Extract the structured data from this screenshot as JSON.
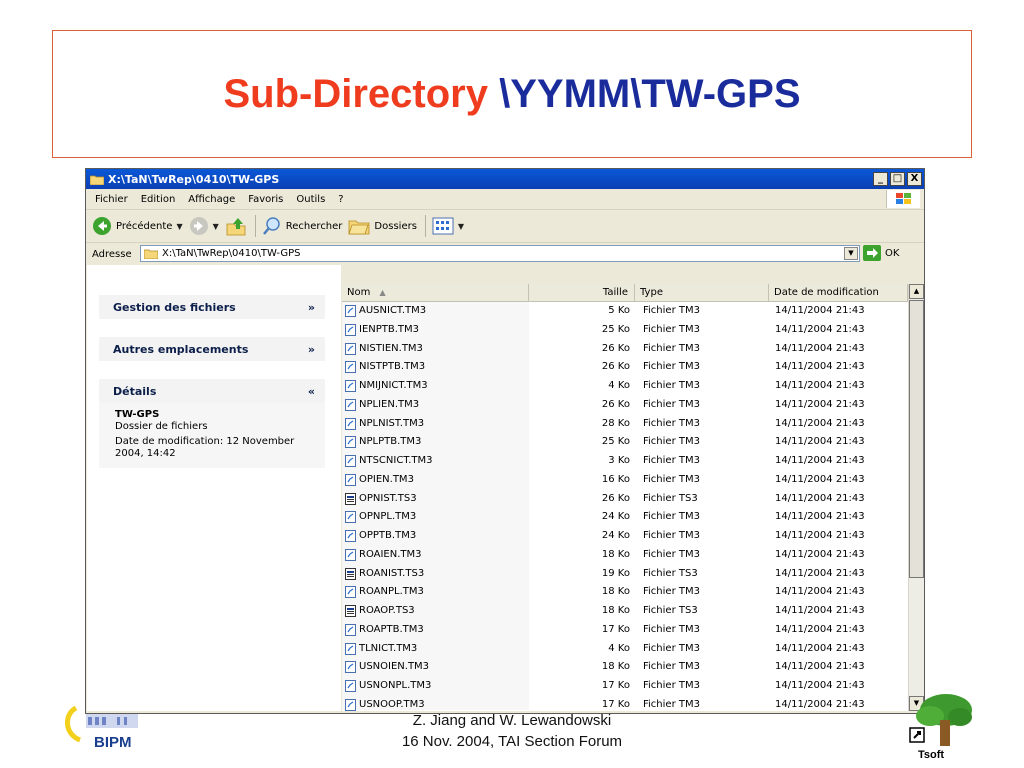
{
  "slide": {
    "title_part1": "Sub-Directory ",
    "title_part2": "\\YYMM\\TW-GPS",
    "footer_line1": "Z. Jiang and W. Lewandowski",
    "footer_line2": "16 Nov. 2004, TAI Section Forum",
    "logo_left": "BIPM",
    "logo_right": "Tsoft"
  },
  "window": {
    "title": "X:\\TaN\\TwRep\\0410\\TW-GPS",
    "controls": [
      "_",
      "□",
      "X"
    ]
  },
  "menu": [
    "Fichier",
    "Edition",
    "Affichage",
    "Favoris",
    "Outils",
    "?"
  ],
  "toolbar": {
    "back_label": "Précédente",
    "search_label": "Rechercher",
    "folders_label": "Dossiers"
  },
  "address": {
    "label": "Adresse",
    "value": "X:\\TaN\\TwRep\\0410\\TW-GPS",
    "go_label": "OK"
  },
  "taskpane": {
    "sections": [
      {
        "title": "Gestion des fichiers",
        "chevron": "»"
      },
      {
        "title": "Autres emplacements",
        "chevron": "»"
      },
      {
        "title": "Détails",
        "chevron": "«"
      }
    ],
    "details": {
      "name": "TW-GPS",
      "kind": "Dossier de fichiers",
      "modified": "Date de modification: 12 November 2004, 14:42"
    }
  },
  "columns": [
    "Nom",
    "Taille",
    "Type",
    "Date de modification"
  ],
  "files": [
    {
      "name": "AUSNICT.TM3",
      "size": "5 Ko",
      "type": "Fichier TM3",
      "date": "14/11/2004 21:43",
      "icon": "doc-icon"
    },
    {
      "name": "IENPTB.TM3",
      "size": "25 Ko",
      "type": "Fichier TM3",
      "date": "14/11/2004 21:43",
      "icon": "doc-icon"
    },
    {
      "name": "NISTIEN.TM3",
      "size": "26 Ko",
      "type": "Fichier TM3",
      "date": "14/11/2004 21:43",
      "icon": "doc-icon"
    },
    {
      "name": "NISTPTB.TM3",
      "size": "26 Ko",
      "type": "Fichier TM3",
      "date": "14/11/2004 21:43",
      "icon": "doc-icon"
    },
    {
      "name": "NMIJNICT.TM3",
      "size": "4 Ko",
      "type": "Fichier TM3",
      "date": "14/11/2004 21:43",
      "icon": "doc-icon"
    },
    {
      "name": "NPLIEN.TM3",
      "size": "26 Ko",
      "type": "Fichier TM3",
      "date": "14/11/2004 21:43",
      "icon": "doc-icon"
    },
    {
      "name": "NPLNIST.TM3",
      "size": "28 Ko",
      "type": "Fichier TM3",
      "date": "14/11/2004 21:43",
      "icon": "doc-icon"
    },
    {
      "name": "NPLPTB.TM3",
      "size": "25 Ko",
      "type": "Fichier TM3",
      "date": "14/11/2004 21:43",
      "icon": "doc-icon"
    },
    {
      "name": "NTSCNICT.TM3",
      "size": "3 Ko",
      "type": "Fichier TM3",
      "date": "14/11/2004 21:43",
      "icon": "doc-icon"
    },
    {
      "name": "OPIEN.TM3",
      "size": "16 Ko",
      "type": "Fichier TM3",
      "date": "14/11/2004 21:43",
      "icon": "doc-icon"
    },
    {
      "name": "OPNIST.TS3",
      "size": "26 Ko",
      "type": "Fichier TS3",
      "date": "14/11/2004 21:43",
      "icon": "ts3-icon"
    },
    {
      "name": "OPNPL.TM3",
      "size": "24 Ko",
      "type": "Fichier TM3",
      "date": "14/11/2004 21:43",
      "icon": "doc-icon"
    },
    {
      "name": "OPPTB.TM3",
      "size": "24 Ko",
      "type": "Fichier TM3",
      "date": "14/11/2004 21:43",
      "icon": "doc-icon"
    },
    {
      "name": "ROAIEN.TM3",
      "size": "18 Ko",
      "type": "Fichier TM3",
      "date": "14/11/2004 21:43",
      "icon": "doc-icon"
    },
    {
      "name": "ROANIST.TS3",
      "size": "19 Ko",
      "type": "Fichier TS3",
      "date": "14/11/2004 21:43",
      "icon": "ts3-icon"
    },
    {
      "name": "ROANPL.TM3",
      "size": "18 Ko",
      "type": "Fichier TM3",
      "date": "14/11/2004 21:43",
      "icon": "doc-icon"
    },
    {
      "name": "ROAOP.TS3",
      "size": "18 Ko",
      "type": "Fichier TS3",
      "date": "14/11/2004 21:43",
      "icon": "ts3-icon"
    },
    {
      "name": "ROAPTB.TM3",
      "size": "17 Ko",
      "type": "Fichier TM3",
      "date": "14/11/2004 21:43",
      "icon": "doc-icon"
    },
    {
      "name": "TLNICT.TM3",
      "size": "4 Ko",
      "type": "Fichier TM3",
      "date": "14/11/2004 21:43",
      "icon": "doc-icon"
    },
    {
      "name": "USNOIEN.TM3",
      "size": "18 Ko",
      "type": "Fichier TM3",
      "date": "14/11/2004 21:43",
      "icon": "doc-icon"
    },
    {
      "name": "USNONPL.TM3",
      "size": "17 Ko",
      "type": "Fichier TM3",
      "date": "14/11/2004 21:43",
      "icon": "doc-icon"
    },
    {
      "name": "USNOOP.TM3",
      "size": "17 Ko",
      "type": "Fichier TM3",
      "date": "14/11/2004 21:43",
      "icon": "doc-icon"
    }
  ],
  "colors": {
    "title_red": "#f03c1e",
    "title_blue": "#1a2c9c",
    "titlebar": "#0a58d8"
  }
}
